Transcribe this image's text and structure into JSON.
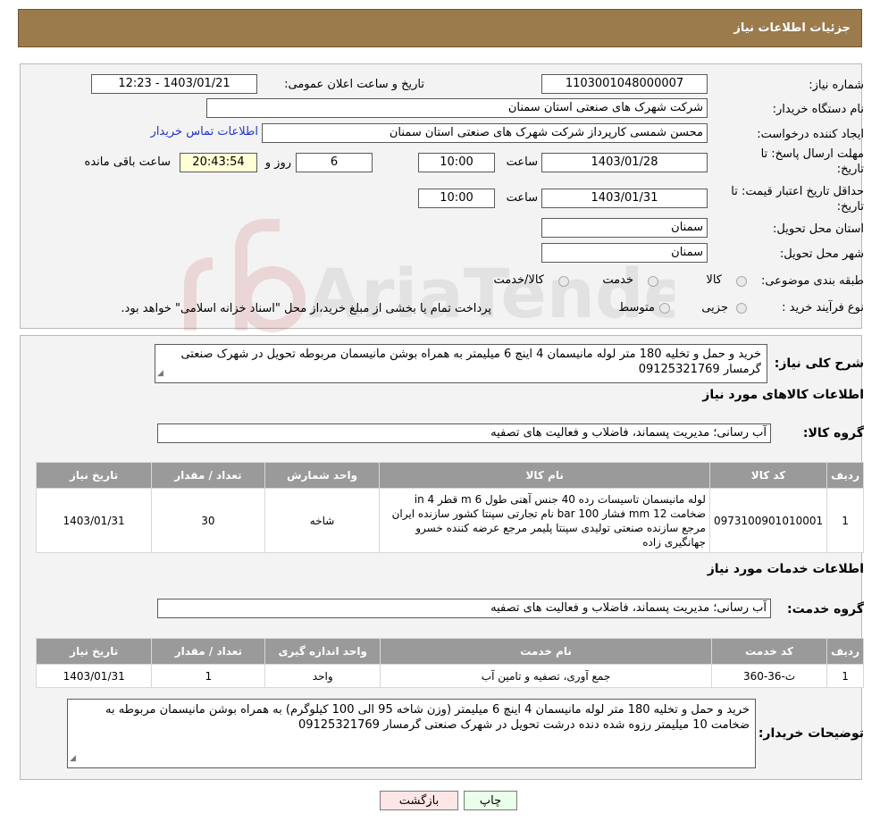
{
  "header": {
    "title": "جزئیات اطلاعات نیاز"
  },
  "details": {
    "need_number_label": "شماره نیاز:",
    "need_number": "1103001048000007",
    "announce_label": "تاریخ و ساعت اعلان عمومی:",
    "announce_value": "1403/01/21 - 12:23",
    "buyer_org_label": "نام دستگاه خریدار:",
    "buyer_org": "شرکت شهرک های صنعتی استان سمنان",
    "creator_label": "ایجاد کننده درخواست:",
    "creator": "محسن شمسی کارپرداز شرکت شهرک های صنعتی استان سمنان",
    "contact_link": "اطلاعات تماس خریدار",
    "deadline_label_1": "مهلت ارسال پاسخ: تا",
    "deadline_label_2": "تاریخ:",
    "deadline_date": "1403/01/28",
    "time_word": "ساعت",
    "deadline_time": "10:00",
    "days_value": "6",
    "days_word": "روز و",
    "remaining_time": "20:43:54",
    "remaining_word": "ساعت باقی مانده",
    "price_validity_label_1": "حداقل تاریخ اعتبار قیمت: تا",
    "price_validity_label_2": "تاریخ:",
    "price_validity_date": "1403/01/31",
    "price_validity_time": "10:00",
    "province_label": "استان محل تحویل:",
    "province": "سمنان",
    "city_label": "شهر محل تحویل:",
    "city": "سمنان",
    "category_label": "طبقه بندی موضوعی:",
    "category_options": [
      "کالا",
      "خدمت",
      "کالا/خدمت"
    ],
    "process_label": "نوع فرآیند خرید :",
    "process_options": [
      "جزیی",
      "متوسط"
    ],
    "process_note": "پرداخت تمام یا بخشی از مبلغ خرید،از محل \"اسناد خزانه اسلامی\" خواهد بود."
  },
  "summary": {
    "label": "شرح کلی نیاز:",
    "text": "خرید و حمل و تخلیه 180 متر لوله مانیسمان 4 اینچ 6 میلیمتر به همراه بوشن مانیسمان مربوطه تحویل در شهرک صنعتی گرمسار 09125321769"
  },
  "goods": {
    "section_title": "اطلاعات کالاهای مورد نیاز",
    "group_label": "گروه کالا:",
    "group_value": "آب رسانی؛ مدیریت پسماند، فاضلاب و فعالیت های تصفیه",
    "columns": [
      "ردیف",
      "کد کالا",
      "نام کالا",
      "واحد شمارش",
      "تعداد / مقدار",
      "تاریخ نیاز"
    ],
    "rows": [
      {
        "row": "1",
        "code": "0973100901010001",
        "name": "لوله مانیسمان تاسیسات رده 40 جنس آهنی طول 6 m قطر 4 in ضخامت 12 mm فشار 100 bar نام تجارتی سپنتا کشور سازنده ایران مرجع سازنده صنعتی تولیدی سپنتا پلیمر مرجع عرضه کننده خسرو جهانگیری زاده",
        "unit": "شاخه",
        "qty": "30",
        "date": "1403/01/31"
      }
    ]
  },
  "services": {
    "section_title": "اطلاعات خدمات مورد نیاز",
    "group_label": "گروه خدمت:",
    "group_value": "آب رسانی؛ مدیریت پسماند، فاضلاب و فعالیت های تصفیه",
    "columns": [
      "ردیف",
      "کد خدمت",
      "نام خدمت",
      "واحد اندازه گیری",
      "تعداد / مقدار",
      "تاریخ نیاز"
    ],
    "rows": [
      {
        "row": "1",
        "code": "ث-36-360",
        "name": "جمع آوری، تصفیه و تامین آب",
        "unit": "واحد",
        "qty": "1",
        "date": "1403/01/31"
      }
    ]
  },
  "buyer_notes": {
    "label": "توضیحات خریدار:",
    "text": "خرید و حمل و تخلیه 180 متر لوله مانیسمان 4 اینچ 6 میلیمتر (وزن شاخه 95 الی 100 کیلوگرم) به همراه بوشن مانیسمان مربوطه به ضخامت 10 میلیمتر رزوه شده دنده درشت تحویل در شهرک صنعتی گرمسار 09125321769"
  },
  "buttons": {
    "print": "چاپ",
    "back": "بازگشت"
  },
  "watermark": {
    "text": "AriaTender.neT"
  }
}
